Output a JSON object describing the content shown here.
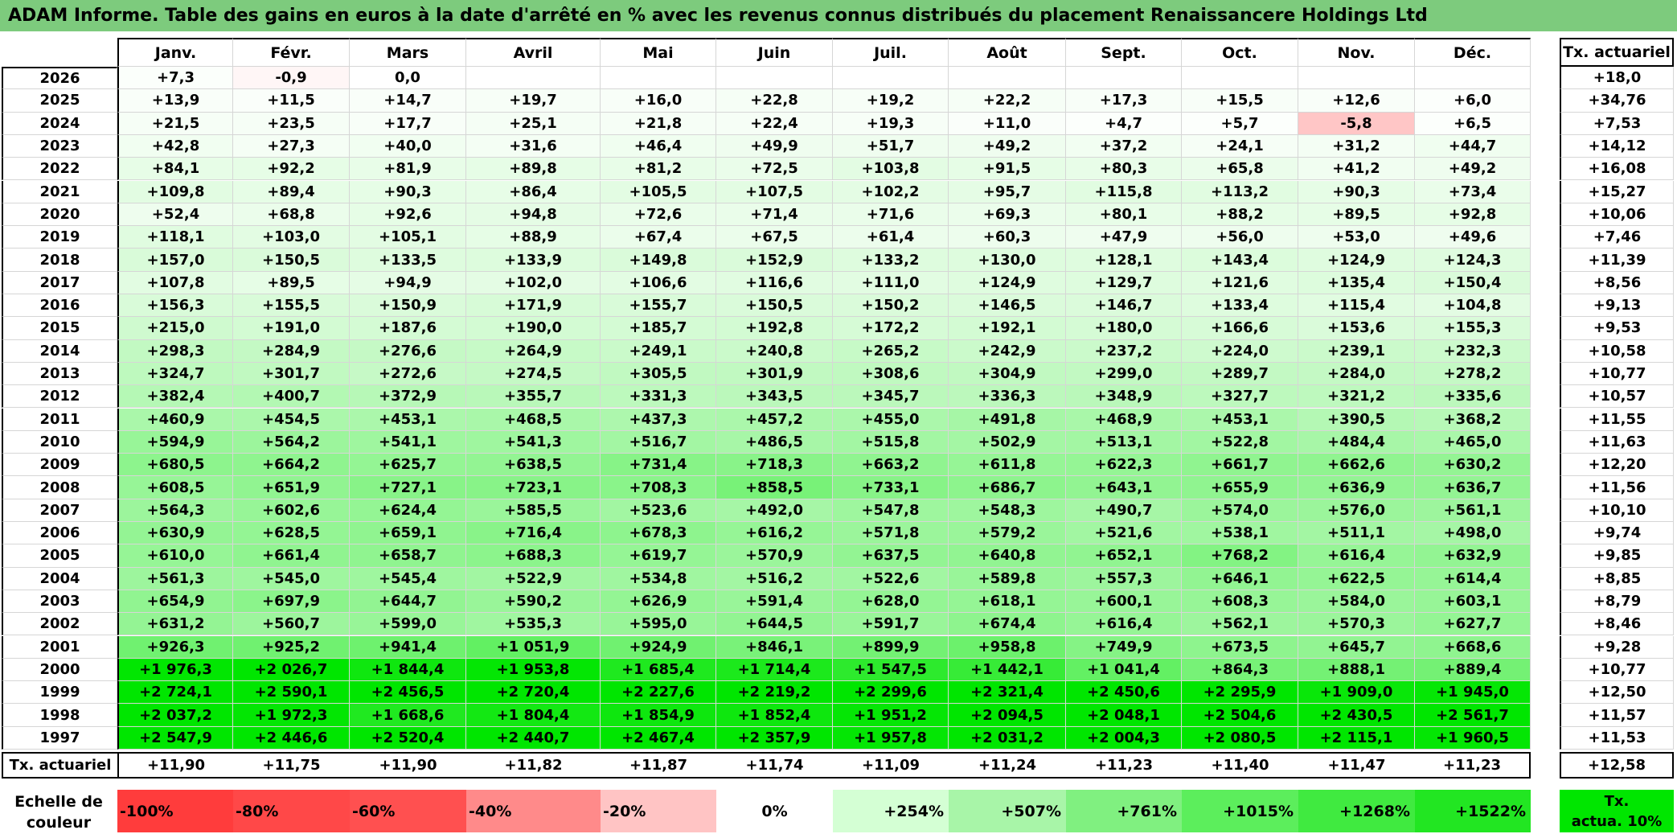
{
  "title": "ADAM Informe. Table des gains en euros à la date d'arrêté en % avec les revenus connus distribués du placement Renaissancere Holdings Ltd",
  "months": [
    "Janv.",
    "Févr.",
    "Mars",
    "Avril",
    "Mai",
    "Juin",
    "Juil.",
    "Août",
    "Sept.",
    "Oct.",
    "Nov.",
    "Déc."
  ],
  "annual_header": "Tx. actuariel",
  "rows": [
    {
      "year": "2026",
      "values": [
        "+7,3",
        "-0,9",
        "0,0",
        "",
        "",
        "",
        "",
        "",
        "",
        "",
        "",
        ""
      ],
      "annual": "+18,0"
    },
    {
      "year": "2025",
      "values": [
        "+13,9",
        "+11,5",
        "+14,7",
        "+19,7",
        "+16,0",
        "+22,8",
        "+19,2",
        "+22,2",
        "+17,3",
        "+15,5",
        "+12,6",
        "+6,0"
      ],
      "annual": "+34,76"
    },
    {
      "year": "2024",
      "values": [
        "+21,5",
        "+23,5",
        "+17,7",
        "+25,1",
        "+21,8",
        "+22,4",
        "+19,3",
        "+11,0",
        "+4,7",
        "+5,7",
        "-5,8",
        "+6,5"
      ],
      "annual": "+7,53"
    },
    {
      "year": "2023",
      "values": [
        "+42,8",
        "+27,3",
        "+40,0",
        "+31,6",
        "+46,4",
        "+49,9",
        "+51,7",
        "+49,2",
        "+37,2",
        "+24,1",
        "+31,2",
        "+44,7"
      ],
      "annual": "+14,12"
    },
    {
      "year": "2022",
      "values": [
        "+84,1",
        "+92,2",
        "+81,9",
        "+89,8",
        "+81,2",
        "+72,5",
        "+103,8",
        "+91,5",
        "+80,3",
        "+65,8",
        "+41,2",
        "+49,2"
      ],
      "annual": "+16,08"
    },
    {
      "year": "2021",
      "values": [
        "+109,8",
        "+89,4",
        "+90,3",
        "+86,4",
        "+105,5",
        "+107,5",
        "+102,2",
        "+95,7",
        "+115,8",
        "+113,2",
        "+90,3",
        "+73,4"
      ],
      "annual": "+15,27"
    },
    {
      "year": "2020",
      "values": [
        "+52,4",
        "+68,8",
        "+92,6",
        "+94,8",
        "+72,6",
        "+71,4",
        "+71,6",
        "+69,3",
        "+80,1",
        "+88,2",
        "+89,5",
        "+92,8"
      ],
      "annual": "+10,06"
    },
    {
      "year": "2019",
      "values": [
        "+118,1",
        "+103,0",
        "+105,1",
        "+88,9",
        "+67,4",
        "+67,5",
        "+61,4",
        "+60,3",
        "+47,9",
        "+56,0",
        "+53,0",
        "+49,6"
      ],
      "annual": "+7,46"
    },
    {
      "year": "2018",
      "values": [
        "+157,0",
        "+150,5",
        "+133,5",
        "+133,9",
        "+149,8",
        "+152,9",
        "+133,2",
        "+130,0",
        "+128,1",
        "+143,4",
        "+124,9",
        "+124,3"
      ],
      "annual": "+11,39"
    },
    {
      "year": "2017",
      "values": [
        "+107,8",
        "+89,5",
        "+94,9",
        "+102,0",
        "+106,6",
        "+116,6",
        "+111,0",
        "+124,9",
        "+129,7",
        "+121,6",
        "+135,4",
        "+150,4"
      ],
      "annual": "+8,56"
    },
    {
      "year": "2016",
      "values": [
        "+156,3",
        "+155,5",
        "+150,9",
        "+171,9",
        "+155,7",
        "+150,5",
        "+150,2",
        "+146,5",
        "+146,7",
        "+133,4",
        "+115,4",
        "+104,8"
      ],
      "annual": "+9,13"
    },
    {
      "year": "2015",
      "values": [
        "+215,0",
        "+191,0",
        "+187,6",
        "+190,0",
        "+185,7",
        "+192,8",
        "+172,2",
        "+192,1",
        "+180,0",
        "+166,6",
        "+153,6",
        "+155,3"
      ],
      "annual": "+9,53"
    },
    {
      "year": "2014",
      "values": [
        "+298,3",
        "+284,9",
        "+276,6",
        "+264,9",
        "+249,1",
        "+240,8",
        "+265,2",
        "+242,9",
        "+237,2",
        "+224,0",
        "+239,1",
        "+232,3"
      ],
      "annual": "+10,58"
    },
    {
      "year": "2013",
      "values": [
        "+324,7",
        "+301,7",
        "+272,6",
        "+274,5",
        "+305,5",
        "+301,9",
        "+308,6",
        "+304,9",
        "+299,0",
        "+289,7",
        "+284,0",
        "+278,2"
      ],
      "annual": "+10,77"
    },
    {
      "year": "2012",
      "values": [
        "+382,4",
        "+400,7",
        "+372,9",
        "+355,7",
        "+331,3",
        "+343,5",
        "+345,7",
        "+336,3",
        "+348,9",
        "+327,7",
        "+321,2",
        "+335,6"
      ],
      "annual": "+10,57"
    },
    {
      "year": "2011",
      "values": [
        "+460,9",
        "+454,5",
        "+453,1",
        "+468,5",
        "+437,3",
        "+457,2",
        "+455,0",
        "+491,8",
        "+468,9",
        "+453,1",
        "+390,5",
        "+368,2"
      ],
      "annual": "+11,55"
    },
    {
      "year": "2010",
      "values": [
        "+594,9",
        "+564,2",
        "+541,1",
        "+541,3",
        "+516,7",
        "+486,5",
        "+515,8",
        "+502,9",
        "+513,1",
        "+522,8",
        "+484,4",
        "+465,0"
      ],
      "annual": "+11,63"
    },
    {
      "year": "2009",
      "values": [
        "+680,5",
        "+664,2",
        "+625,7",
        "+638,5",
        "+731,4",
        "+718,3",
        "+663,2",
        "+611,8",
        "+622,3",
        "+661,7",
        "+662,6",
        "+630,2"
      ],
      "annual": "+12,20"
    },
    {
      "year": "2008",
      "values": [
        "+608,5",
        "+651,9",
        "+727,1",
        "+723,1",
        "+708,3",
        "+858,5",
        "+733,1",
        "+686,7",
        "+643,1",
        "+655,9",
        "+636,9",
        "+636,7"
      ],
      "annual": "+11,56"
    },
    {
      "year": "2007",
      "values": [
        "+564,3",
        "+602,6",
        "+624,4",
        "+585,5",
        "+523,6",
        "+492,0",
        "+547,8",
        "+548,3",
        "+490,7",
        "+574,0",
        "+576,0",
        "+561,1"
      ],
      "annual": "+10,10"
    },
    {
      "year": "2006",
      "values": [
        "+630,9",
        "+628,5",
        "+659,1",
        "+716,4",
        "+678,3",
        "+616,2",
        "+571,8",
        "+579,2",
        "+521,6",
        "+538,1",
        "+511,1",
        "+498,0"
      ],
      "annual": "+9,74"
    },
    {
      "year": "2005",
      "values": [
        "+610,0",
        "+661,4",
        "+658,7",
        "+688,3",
        "+619,7",
        "+570,9",
        "+637,5",
        "+640,8",
        "+652,1",
        "+768,2",
        "+616,4",
        "+632,9"
      ],
      "annual": "+9,85"
    },
    {
      "year": "2004",
      "values": [
        "+561,3",
        "+545,0",
        "+545,4",
        "+522,9",
        "+534,8",
        "+516,2",
        "+522,6",
        "+589,8",
        "+557,3",
        "+646,1",
        "+622,5",
        "+614,4"
      ],
      "annual": "+8,85"
    },
    {
      "year": "2003",
      "values": [
        "+654,9",
        "+697,9",
        "+644,7",
        "+590,2",
        "+626,9",
        "+591,4",
        "+628,0",
        "+618,1",
        "+600,1",
        "+608,3",
        "+584,0",
        "+603,1"
      ],
      "annual": "+8,79"
    },
    {
      "year": "2002",
      "values": [
        "+631,2",
        "+560,7",
        "+599,0",
        "+535,3",
        "+595,0",
        "+644,5",
        "+591,7",
        "+674,4",
        "+616,4",
        "+562,1",
        "+570,3",
        "+627,7"
      ],
      "annual": "+8,46"
    },
    {
      "year": "2001",
      "values": [
        "+926,3",
        "+925,2",
        "+941,4",
        "+1 051,9",
        "+924,9",
        "+846,1",
        "+899,9",
        "+958,8",
        "+749,9",
        "+673,5",
        "+645,7",
        "+668,6"
      ],
      "annual": "+9,28"
    },
    {
      "year": "2000",
      "values": [
        "+1 976,3",
        "+2 026,7",
        "+1 844,4",
        "+1 953,8",
        "+1 685,4",
        "+1 714,4",
        "+1 547,5",
        "+1 442,1",
        "+1 041,4",
        "+864,3",
        "+888,1",
        "+889,4"
      ],
      "annual": "+10,77"
    },
    {
      "year": "1999",
      "values": [
        "+2 724,1",
        "+2 590,1",
        "+2 456,5",
        "+2 720,4",
        "+2 227,6",
        "+2 219,2",
        "+2 299,6",
        "+2 321,4",
        "+2 450,6",
        "+2 295,9",
        "+1 909,0",
        "+1 945,0"
      ],
      "annual": "+12,50"
    },
    {
      "year": "1998",
      "values": [
        "+2 037,2",
        "+1 972,3",
        "+1 668,6",
        "+1 804,4",
        "+1 854,9",
        "+1 852,4",
        "+1 951,2",
        "+2 094,5",
        "+2 048,1",
        "+2 504,6",
        "+2 430,5",
        "+2 561,7"
      ],
      "annual": "+11,57"
    },
    {
      "year": "1997",
      "values": [
        "+2 547,9",
        "+2 446,6",
        "+2 520,4",
        "+2 440,7",
        "+2 467,4",
        "+2 357,9",
        "+1 957,8",
        "+2 031,2",
        "+2 004,3",
        "+2 080,5",
        "+2 115,1",
        "+1 960,5"
      ],
      "annual": "+11,53"
    }
  ],
  "footer": {
    "label": "Tx. actuariel",
    "values": [
      "+11,90",
      "+11,75",
      "+11,90",
      "+11,82",
      "+11,87",
      "+11,74",
      "+11,09",
      "+11,24",
      "+11,23",
      "+11,40",
      "+11,47",
      "+11,23"
    ],
    "annual": "+12,58"
  },
  "scale": {
    "title_line1": "Echelle de",
    "title_line2": "couleur",
    "items": [
      {
        "label": "-100%",
        "color": "#ff3c3c"
      },
      {
        "label": "-80%",
        "color": "#ff4848"
      },
      {
        "label": "-60%",
        "color": "#ff5050"
      },
      {
        "label": "-40%",
        "color": "#ff8a8a"
      },
      {
        "label": "-20%",
        "color": "#ffc4c4"
      },
      {
        "label": "0%",
        "color": "#ffffff"
      },
      {
        "label": "+254%",
        "color": "#d4ffd4"
      },
      {
        "label": "+507%",
        "color": "#a8f5a8"
      },
      {
        "label": "+761%",
        "color": "#80f080"
      },
      {
        "label": "+1015%",
        "color": "#5cee5c"
      },
      {
        "label": "+1268%",
        "color": "#40ea40"
      },
      {
        "label": "+1522%",
        "color": "#22e622"
      }
    ],
    "tx_line1": "Tx.",
    "tx_line2": "actua. 10%",
    "tx_color": "#00e600"
  },
  "colors": {
    "title_bar": "#7dcb7d",
    "positive_max": "#00e600",
    "negative": "#ff3c3c"
  }
}
